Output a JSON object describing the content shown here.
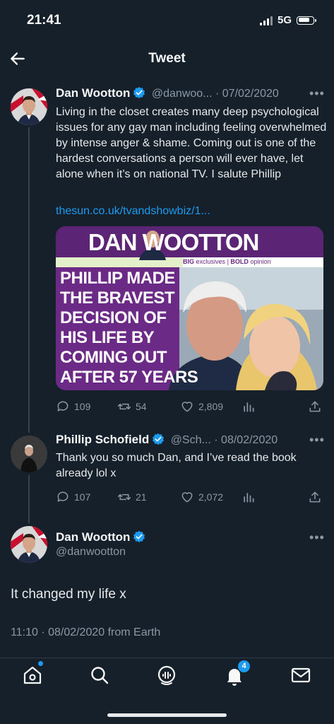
{
  "status": {
    "time": "21:41",
    "network": "5G"
  },
  "header": {
    "title": "Tweet"
  },
  "tweet1": {
    "name": "Dan Wootton",
    "handle_date": "@danwoo... · 07/02/2020",
    "text": "Living in the closet creates many deep psychological issues for any gay man including feeling overwhelmed by intense anger & shame. Coming out is one of the hardest conversations a person will ever have, let alone when it’s on national TV. I salute Phillip",
    "link": "thesun.co.uk/tvandshowbiz/1...",
    "card": {
      "brand": "DAN WOOTTON",
      "tagline_big": "BIG",
      "tagline_exclusives": "exclusives",
      "tagline_sep": "|",
      "tagline_bold": "BOLD",
      "tagline_opinion": "opinion",
      "headline": [
        "PHILLIP MADE",
        "THE BRAVEST",
        "DECISION OF",
        "HIS LIFE BY",
        "COMING OUT",
        "AFTER 57 YEARS"
      ]
    },
    "replies": "109",
    "retweets": "54",
    "likes": "2,809"
  },
  "tweet2": {
    "name": "Phillip Schofield",
    "handle_date": "@Sch... · 08/02/2020",
    "text": "Thank you so much Dan, and I’ve read the book already lol x",
    "replies": "107",
    "retweets": "21",
    "likes": "2,072"
  },
  "main_tweet": {
    "name": "Dan Wootton",
    "handle": "@danwootton",
    "text": "It changed my life x",
    "meta": "11:10 · 08/02/2020 from Earth"
  },
  "nav": {
    "notifications_badge": "4"
  },
  "colors": {
    "background": "#15202b",
    "accent": "#1d9bf0",
    "muted": "#8b98a5"
  }
}
